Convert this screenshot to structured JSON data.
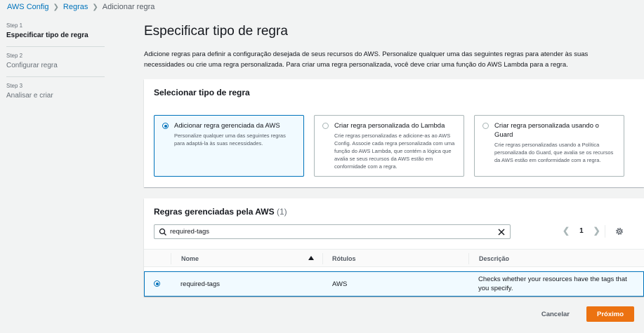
{
  "breadcrumb": {
    "items": [
      "AWS Config",
      "Regras",
      "Adicionar regra"
    ]
  },
  "steps": [
    {
      "num": "Step 1",
      "title": "Especificar tipo de regra",
      "active": true
    },
    {
      "num": "Step 2",
      "title": "Configurar regra",
      "active": false
    },
    {
      "num": "Step 3",
      "title": "Analisar e criar",
      "active": false
    }
  ],
  "main": {
    "title": "Especificar tipo de regra",
    "description": "Adicione regras para definir a configuração desejada de seus recursos do AWS. Personalize qualquer uma das seguintes regras para atender às suas necessidades ou crie uma regra personalizada. Para criar uma regra personalizada, você deve criar uma função do AWS Lambda para a regra."
  },
  "rule_type": {
    "title": "Selecionar tipo de regra",
    "options": [
      {
        "title": "Adicionar regra gerenciada da AWS",
        "desc": "Personalize qualquer uma das seguintes regras para adaptá-la às suas necessidades.",
        "selected": true
      },
      {
        "title": "Criar regra personalizada do Lambda",
        "desc": "Crie regras personalizadas e adicione-as ao AWS Config. Associe cada regra personalizada com uma função do AWS Lambda, que contém a lógica que avalia se seus recursos da AWS estão em conformidade com a regra.",
        "selected": false
      },
      {
        "title": "Criar regra personalizada usando o Guard",
        "desc": "Crie regras personalizadas usando a Política personalizada do Guard, que avalia se os recursos da AWS estão em conformidade com a regra.",
        "selected": false
      }
    ]
  },
  "managed_rules": {
    "title": "Regras gerenciadas pela AWS",
    "count": "(1)",
    "search_value": "required-tags",
    "page": "1",
    "columns": [
      "Nome",
      "Rótulos",
      "Descrição"
    ],
    "rows": [
      {
        "name": "required-tags",
        "labels": "AWS",
        "description": "Checks whether your resources have the tags that you specify.",
        "selected": true
      }
    ]
  },
  "footer": {
    "cancel_label": "Cancelar",
    "next_label": "Próximo"
  },
  "colors": {
    "accent": "#0073bb",
    "primary_button": "#ec7211"
  }
}
